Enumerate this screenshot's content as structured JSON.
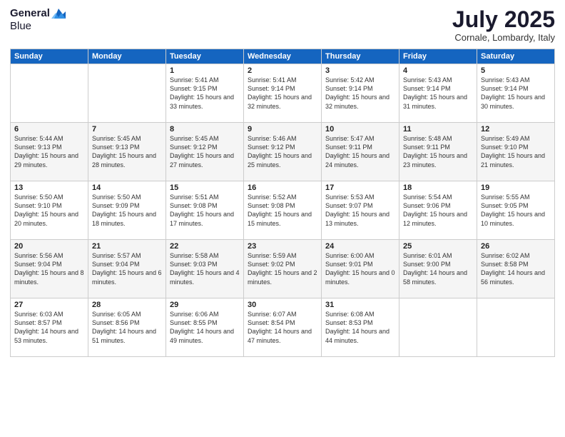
{
  "header": {
    "logo_line1": "General",
    "logo_line2": "Blue",
    "month": "July 2025",
    "location": "Cornale, Lombardy, Italy"
  },
  "weekdays": [
    "Sunday",
    "Monday",
    "Tuesday",
    "Wednesday",
    "Thursday",
    "Friday",
    "Saturday"
  ],
  "weeks": [
    [
      {
        "day": "",
        "content": ""
      },
      {
        "day": "",
        "content": ""
      },
      {
        "day": "1",
        "content": "Sunrise: 5:41 AM\nSunset: 9:15 PM\nDaylight: 15 hours\nand 33 minutes."
      },
      {
        "day": "2",
        "content": "Sunrise: 5:41 AM\nSunset: 9:14 PM\nDaylight: 15 hours\nand 32 minutes."
      },
      {
        "day": "3",
        "content": "Sunrise: 5:42 AM\nSunset: 9:14 PM\nDaylight: 15 hours\nand 32 minutes."
      },
      {
        "day": "4",
        "content": "Sunrise: 5:43 AM\nSunset: 9:14 PM\nDaylight: 15 hours\nand 31 minutes."
      },
      {
        "day": "5",
        "content": "Sunrise: 5:43 AM\nSunset: 9:14 PM\nDaylight: 15 hours\nand 30 minutes."
      }
    ],
    [
      {
        "day": "6",
        "content": "Sunrise: 5:44 AM\nSunset: 9:13 PM\nDaylight: 15 hours\nand 29 minutes."
      },
      {
        "day": "7",
        "content": "Sunrise: 5:45 AM\nSunset: 9:13 PM\nDaylight: 15 hours\nand 28 minutes."
      },
      {
        "day": "8",
        "content": "Sunrise: 5:45 AM\nSunset: 9:12 PM\nDaylight: 15 hours\nand 27 minutes."
      },
      {
        "day": "9",
        "content": "Sunrise: 5:46 AM\nSunset: 9:12 PM\nDaylight: 15 hours\nand 25 minutes."
      },
      {
        "day": "10",
        "content": "Sunrise: 5:47 AM\nSunset: 9:11 PM\nDaylight: 15 hours\nand 24 minutes."
      },
      {
        "day": "11",
        "content": "Sunrise: 5:48 AM\nSunset: 9:11 PM\nDaylight: 15 hours\nand 23 minutes."
      },
      {
        "day": "12",
        "content": "Sunrise: 5:49 AM\nSunset: 9:10 PM\nDaylight: 15 hours\nand 21 minutes."
      }
    ],
    [
      {
        "day": "13",
        "content": "Sunrise: 5:50 AM\nSunset: 9:10 PM\nDaylight: 15 hours\nand 20 minutes."
      },
      {
        "day": "14",
        "content": "Sunrise: 5:50 AM\nSunset: 9:09 PM\nDaylight: 15 hours\nand 18 minutes."
      },
      {
        "day": "15",
        "content": "Sunrise: 5:51 AM\nSunset: 9:08 PM\nDaylight: 15 hours\nand 17 minutes."
      },
      {
        "day": "16",
        "content": "Sunrise: 5:52 AM\nSunset: 9:08 PM\nDaylight: 15 hours\nand 15 minutes."
      },
      {
        "day": "17",
        "content": "Sunrise: 5:53 AM\nSunset: 9:07 PM\nDaylight: 15 hours\nand 13 minutes."
      },
      {
        "day": "18",
        "content": "Sunrise: 5:54 AM\nSunset: 9:06 PM\nDaylight: 15 hours\nand 12 minutes."
      },
      {
        "day": "19",
        "content": "Sunrise: 5:55 AM\nSunset: 9:05 PM\nDaylight: 15 hours\nand 10 minutes."
      }
    ],
    [
      {
        "day": "20",
        "content": "Sunrise: 5:56 AM\nSunset: 9:04 PM\nDaylight: 15 hours\nand 8 minutes."
      },
      {
        "day": "21",
        "content": "Sunrise: 5:57 AM\nSunset: 9:04 PM\nDaylight: 15 hours\nand 6 minutes."
      },
      {
        "day": "22",
        "content": "Sunrise: 5:58 AM\nSunset: 9:03 PM\nDaylight: 15 hours\nand 4 minutes."
      },
      {
        "day": "23",
        "content": "Sunrise: 5:59 AM\nSunset: 9:02 PM\nDaylight: 15 hours\nand 2 minutes."
      },
      {
        "day": "24",
        "content": "Sunrise: 6:00 AM\nSunset: 9:01 PM\nDaylight: 15 hours\nand 0 minutes."
      },
      {
        "day": "25",
        "content": "Sunrise: 6:01 AM\nSunset: 9:00 PM\nDaylight: 14 hours\nand 58 minutes."
      },
      {
        "day": "26",
        "content": "Sunrise: 6:02 AM\nSunset: 8:58 PM\nDaylight: 14 hours\nand 56 minutes."
      }
    ],
    [
      {
        "day": "27",
        "content": "Sunrise: 6:03 AM\nSunset: 8:57 PM\nDaylight: 14 hours\nand 53 minutes."
      },
      {
        "day": "28",
        "content": "Sunrise: 6:05 AM\nSunset: 8:56 PM\nDaylight: 14 hours\nand 51 minutes."
      },
      {
        "day": "29",
        "content": "Sunrise: 6:06 AM\nSunset: 8:55 PM\nDaylight: 14 hours\nand 49 minutes."
      },
      {
        "day": "30",
        "content": "Sunrise: 6:07 AM\nSunset: 8:54 PM\nDaylight: 14 hours\nand 47 minutes."
      },
      {
        "day": "31",
        "content": "Sunrise: 6:08 AM\nSunset: 8:53 PM\nDaylight: 14 hours\nand 44 minutes."
      },
      {
        "day": "",
        "content": ""
      },
      {
        "day": "",
        "content": ""
      }
    ]
  ]
}
